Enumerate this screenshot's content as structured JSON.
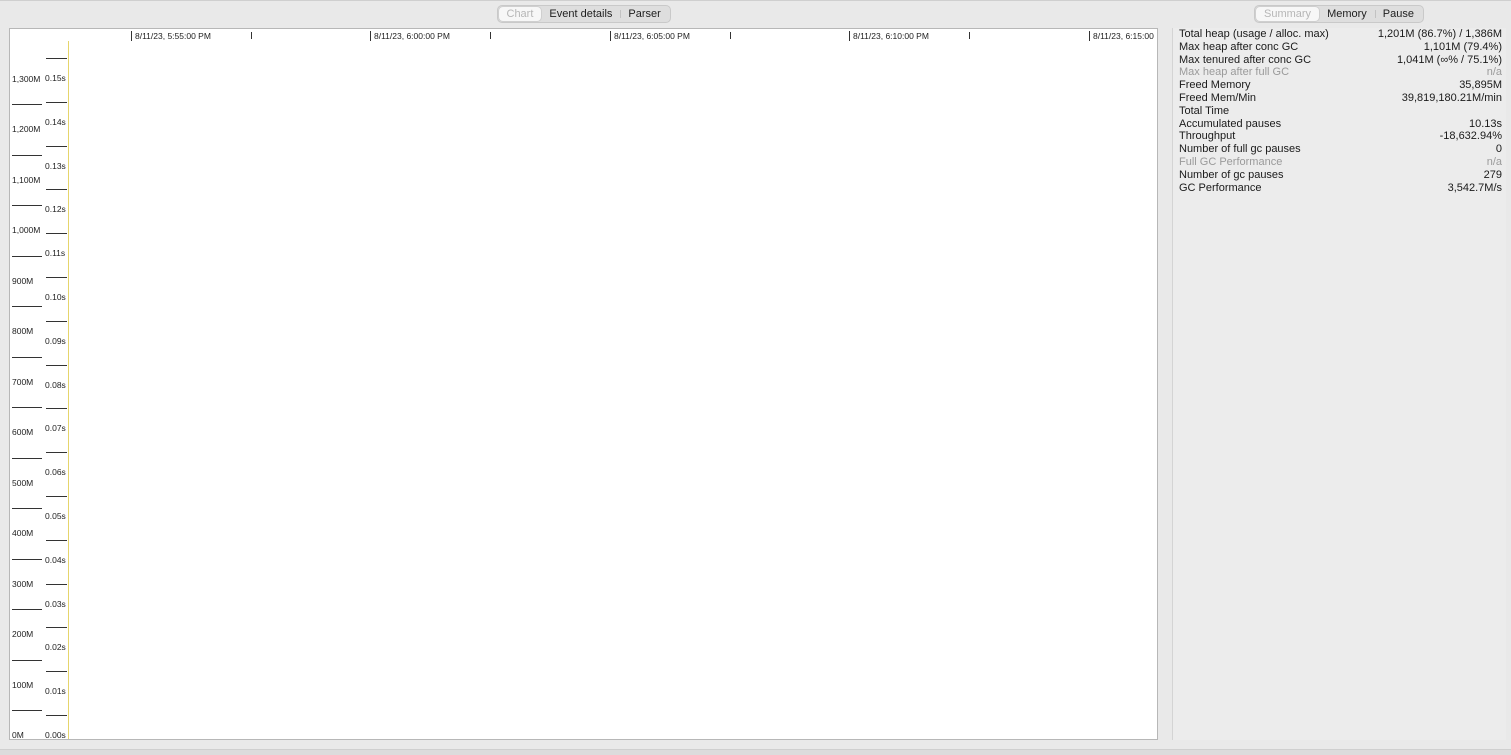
{
  "left_tabs": [
    {
      "label": "Chart",
      "selected": true
    },
    {
      "label": "Event details",
      "selected": false
    },
    {
      "label": "Parser",
      "selected": false
    }
  ],
  "right_tabs": [
    {
      "label": "Summary",
      "selected": true
    },
    {
      "label": "Memory",
      "selected": false
    },
    {
      "label": "Pause",
      "selected": false
    }
  ],
  "chart": {
    "time_axis_labels": [
      "8/11/23, 5:55:00 PM",
      "8/11/23, 6:00:00 PM",
      "8/11/23, 6:05:00 PM",
      "8/11/23, 6:10:00 PM",
      "8/11/23, 6:15:00"
    ],
    "memory_axis_labels": [
      "1,300M",
      "1,200M",
      "1,100M",
      "1,000M",
      "900M",
      "800M",
      "700M",
      "600M",
      "500M",
      "400M",
      "300M",
      "200M",
      "100M",
      "0M"
    ],
    "pause_axis_labels": [
      "0.15s",
      "0.14s",
      "0.13s",
      "0.12s",
      "0.11s",
      "0.10s",
      "0.09s",
      "0.08s",
      "0.07s",
      "0.06s",
      "0.05s",
      "0.04s",
      "0.03s",
      "0.02s",
      "0.01s",
      "0.00s"
    ],
    "pause_axis_color": "#e6d56b"
  },
  "summary": {
    "rows": [
      {
        "key": "Total heap (usage / alloc. max)",
        "value": "1,201M (86.7%) / 1,386M",
        "dim": false
      },
      {
        "key": "Max heap after conc GC",
        "value": "1,101M (79.4%)",
        "dim": false
      },
      {
        "key": "Max tenured after conc GC",
        "value": "1,041M (∞% / 75.1%)",
        "dim": false
      },
      {
        "key": "Max heap after full GC",
        "value": "n/a",
        "dim": true
      },
      {
        "key": "Freed Memory",
        "value": "35,895M",
        "dim": false
      },
      {
        "key": "Freed Mem/Min",
        "value": "39,819,180.21M/min",
        "dim": false
      },
      {
        "key": "Total Time",
        "value": "",
        "dim": false
      },
      {
        "key": "Accumulated pauses",
        "value": "10.13s",
        "dim": false
      },
      {
        "key": "Throughput",
        "value": "-18,632.94%",
        "dim": false
      },
      {
        "key": "Number of full gc pauses",
        "value": "0",
        "dim": false
      },
      {
        "key": "Full GC Performance",
        "value": "n/a",
        "dim": true
      },
      {
        "key": "Number of gc pauses",
        "value": "279",
        "dim": false
      },
      {
        "key": "GC Performance",
        "value": "3,542.7M/s",
        "dim": false
      }
    ]
  }
}
